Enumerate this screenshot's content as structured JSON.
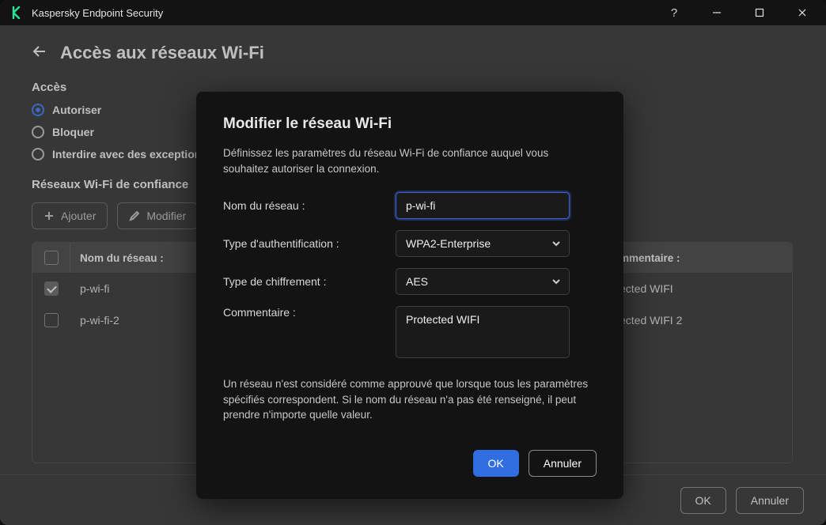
{
  "window": {
    "title": "Kaspersky Endpoint Security"
  },
  "page": {
    "title": "Accès aux réseaux Wi-Fi",
    "access_label": "Accès",
    "radios": {
      "allow": "Autoriser",
      "block": "Bloquer",
      "forbid": "Interdire avec des exceptions"
    },
    "trusted_label": "Réseaux Wi-Fi de confiance",
    "toolbar": {
      "add": "Ajouter",
      "edit": "Modifier"
    },
    "table": {
      "col_name": "Nom du réseau :",
      "col_comment": "mmentaire :",
      "rows": [
        {
          "name": "p-wi-fi",
          "comment": "ected WIFI",
          "checked": true
        },
        {
          "name": "p-wi-fi-2",
          "comment": "ected WIFI 2",
          "checked": false
        }
      ]
    },
    "bottom": {
      "ok": "OK",
      "cancel": "Annuler"
    }
  },
  "modal": {
    "title": "Modifier le réseau Wi-Fi",
    "desc": "Définissez les paramètres du réseau Wi-Fi de confiance auquel vous souhaitez autoriser la connexion.",
    "labels": {
      "name": "Nom du réseau :",
      "auth": "Type d'authentification :",
      "enc": "Type de chiffrement :",
      "comment": "Commentaire :"
    },
    "values": {
      "name": "p-wi-fi",
      "auth": "WPA2-Enterprise",
      "enc": "AES",
      "comment": "Protected WIFI"
    },
    "note": "Un réseau n'est considéré comme approuvé que lorsque tous les paramètres spécifiés correspondent. Si le nom du réseau n'a pas été renseigné, il peut prendre n'importe quelle valeur.",
    "actions": {
      "ok": "OK",
      "cancel": "Annuler"
    }
  }
}
